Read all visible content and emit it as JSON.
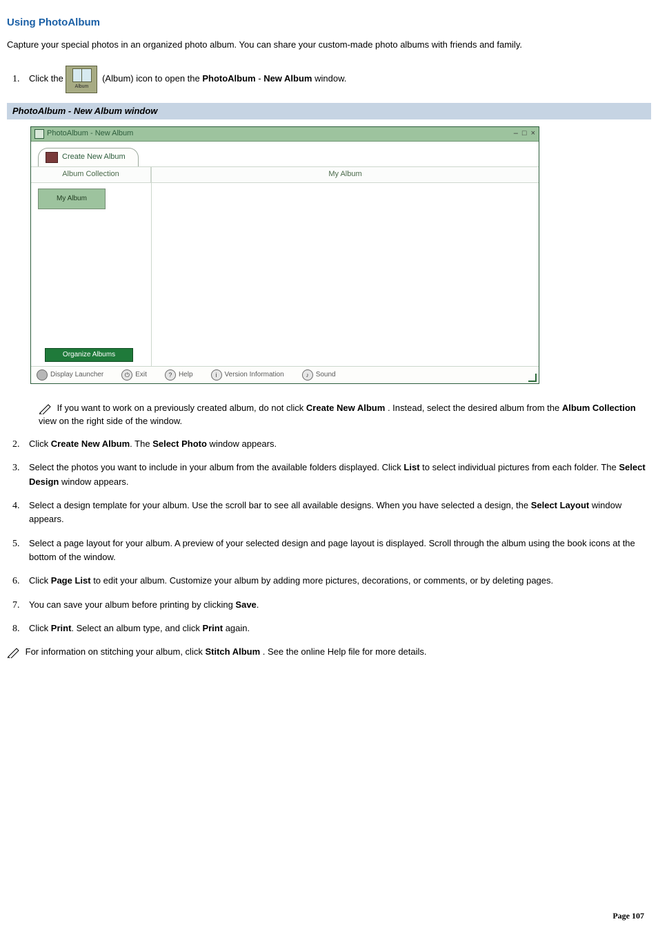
{
  "title": "Using PhotoAlbum",
  "intro": "Capture your special photos in an organized photo album. You can share your custom-made photo albums with friends and family.",
  "step1": {
    "pre": "Click the ",
    "icon_label": "Album",
    "mid": "(Album) icon to open the ",
    "bold1": "PhotoAlbum",
    "dash": " - ",
    "bold2": "New Album",
    "post": " window."
  },
  "section_bar": "PhotoAlbum - New Album window",
  "window": {
    "title": "PhotoAlbum - New Album",
    "controls": {
      "min": "–",
      "max": "□",
      "close": "×"
    },
    "tab": "Create New Album",
    "left_header": "Album Collection",
    "right_header": "My Album",
    "album_item": "My Album",
    "organize": "Organize Albums",
    "footer": {
      "launcher": "Display Launcher",
      "exit": "Exit",
      "help": "Help",
      "version": "Version Information",
      "sound": "Sound"
    }
  },
  "note1": {
    "pre": "If you want to work on a previously created album, do not click ",
    "b1": "Create New Album",
    "mid": ". Instead, select the desired album from the ",
    "b2": "Album Collection",
    "post": " view on the right side of the window."
  },
  "step2": {
    "pre": "Click ",
    "b1": "Create New Album",
    "mid": ". The ",
    "b2": "Select Photo",
    "post": " window appears."
  },
  "step3": {
    "pre": "Select the photos you want to include in your album from the available folders displayed. Click ",
    "b1": "List",
    "mid": " to select individual pictures from each folder. The ",
    "b2": "Select Design",
    "post": " window appears."
  },
  "step4": {
    "pre": "Select a design template for your album. Use the scroll bar to see all available designs. When you have selected a design, the ",
    "b1": "Select Layout",
    "post": " window appears."
  },
  "step5": {
    "text": "Select a page layout for your album. A preview of your selected design and page layout is displayed. Scroll through the album using the book icons at the bottom of the window."
  },
  "step6": {
    "pre": "Click ",
    "b1": "Page List",
    "post": " to edit your album. Customize your album by adding more pictures, decorations, or comments, or by deleting pages."
  },
  "step7": {
    "pre": "You can save your album before printing by clicking ",
    "b1": "Save",
    "post": "."
  },
  "step8": {
    "pre": "Click ",
    "b1": "Print",
    "mid": ". Select an album type, and click ",
    "b2": "Print",
    "post": " again."
  },
  "final_note": {
    "pre": "For information on stitching your album, click ",
    "b1": "Stitch Album",
    "post": ". See the online Help file for more details."
  },
  "page_number": "Page 107"
}
